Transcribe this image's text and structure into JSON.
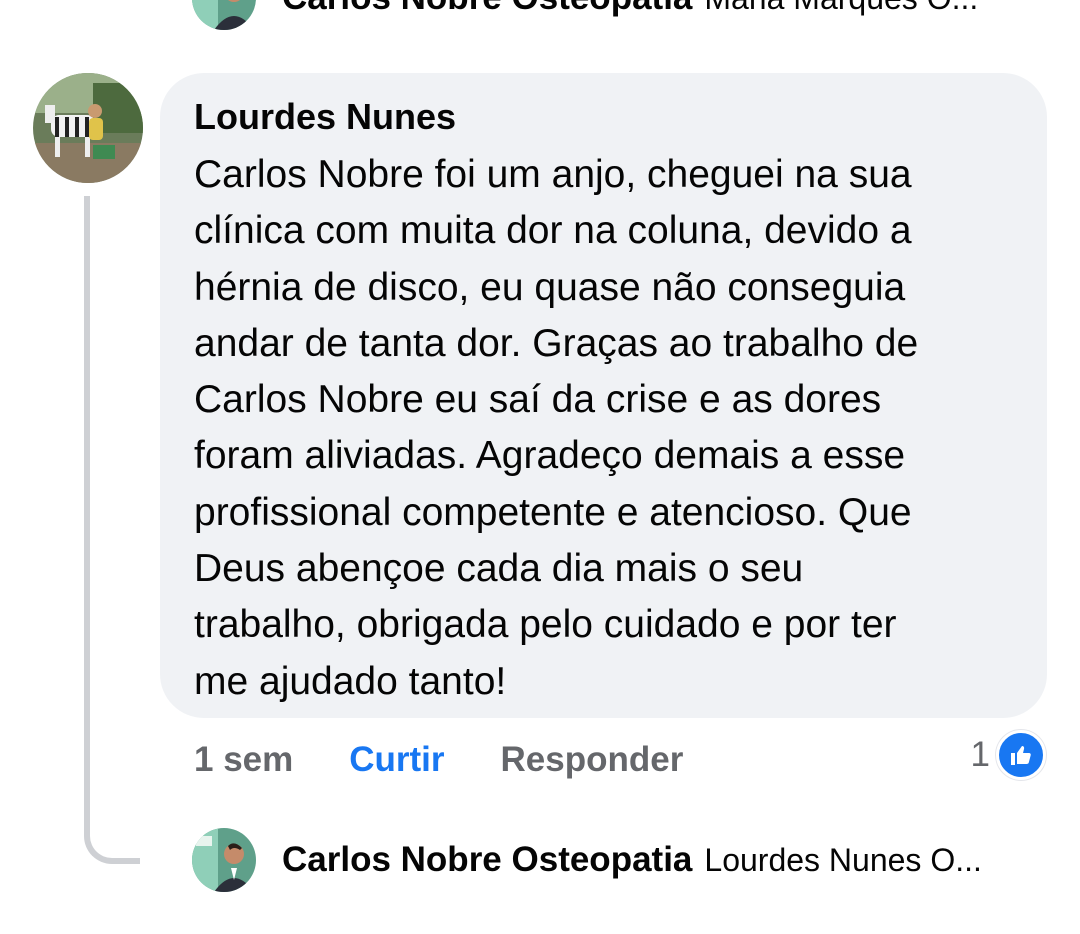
{
  "top_reply": {
    "author": "Carlos Nobre Osteopatia",
    "snippet": "Maria Marques O..."
  },
  "comment": {
    "author": "Lourdes Nunes",
    "text": "Carlos Nobre foi um anjo, cheguei na sua\nclínica com muita dor na coluna, devido a\nhérnia de disco, eu quase não conseguia\nandar de tanta dor. Graças ao trabalho de\nCarlos Nobre eu saí da crise e as dores\nforam aliviadas. Agradeço demais a esse\nprofissional competente e atencioso. Que\nDeus abençoe cada dia mais o seu\ntrabalho, obrigada pelo cuidado e por ter\nme ajudado tanto!",
    "time": "1 sem",
    "like_label": "Curtir",
    "reply_label": "Responder",
    "reaction_count": "1",
    "reaction_icon": "thumbs-up-icon"
  },
  "bottom_reply": {
    "author": "Carlos Nobre Osteopatia",
    "snippet": "Lourdes Nunes  O..."
  },
  "colors": {
    "bubble": "#f0f2f5",
    "accent_blue": "#1877f2",
    "secondary_text": "#65676b",
    "thread_line": "#ced0d4"
  }
}
